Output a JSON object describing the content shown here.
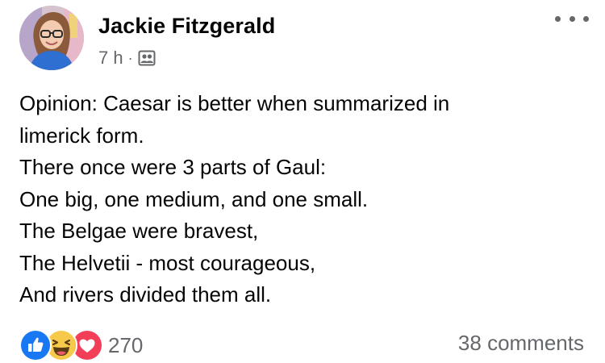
{
  "post": {
    "author_name": "Jackie Fitzgerald",
    "timestamp": "7 h",
    "separator": "·",
    "audience_icon": "group-icon",
    "more_icon": "more-options-icon",
    "text_lines": [
      "Opinion: Caesar is better when summarized in",
      "limerick form.",
      "There once were 3 parts of Gaul:",
      "One big, one medium, and one small.",
      "The Belgae were bravest,",
      "The Helvetii - most courageous,",
      "And rivers divided them all."
    ],
    "reactions": {
      "icons": [
        "like-icon",
        "haha-icon",
        "love-icon"
      ],
      "count": "270"
    },
    "comments": "38 comments"
  },
  "colors": {
    "text_primary": "#050505",
    "text_secondary": "#65676b",
    "like_blue": "#1877f2",
    "haha_yellow": "#f7c94b",
    "love_red": "#f33e58"
  }
}
